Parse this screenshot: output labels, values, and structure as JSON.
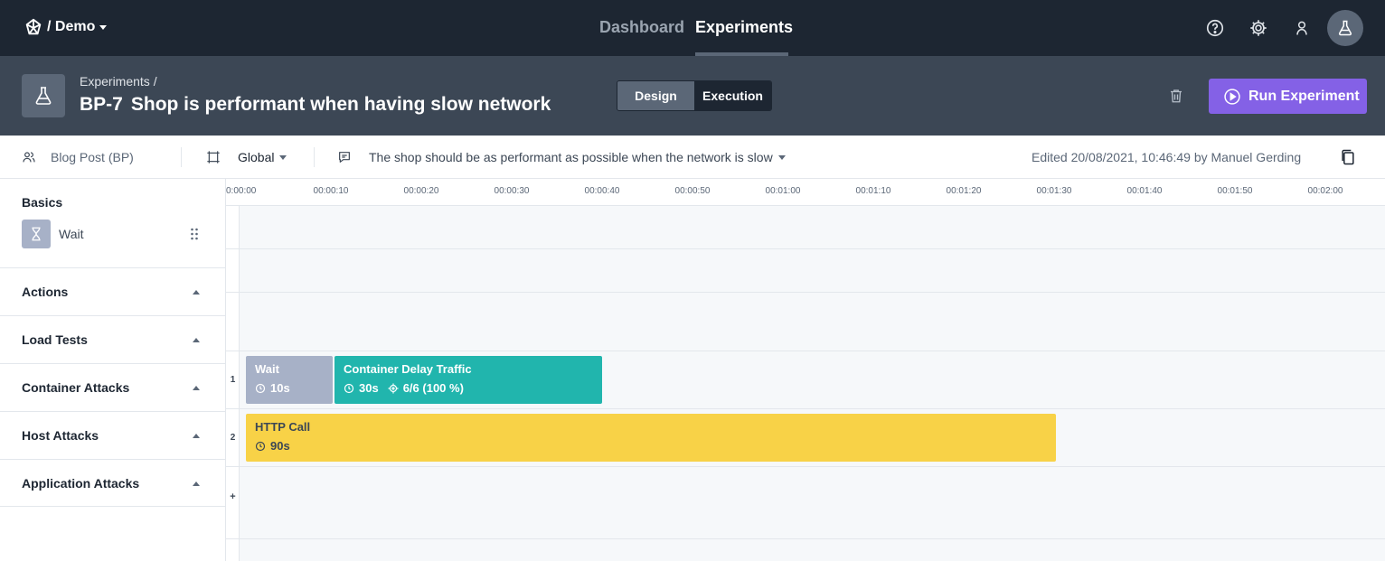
{
  "topnav": {
    "brand": "/ Demo",
    "tabs": [
      {
        "label": "Dashboard",
        "active": false
      },
      {
        "label": "Experiments",
        "active": true
      }
    ],
    "icons": [
      "help-icon",
      "settings-gear-icon",
      "user-icon",
      "flask-icon"
    ]
  },
  "experiment": {
    "breadcrumb": "Experiments /",
    "key": "BP-7",
    "name": "Shop is performant when having slow network",
    "tabs": {
      "design": "Design",
      "execution": "Execution"
    },
    "run_label": "Run Experiment",
    "accent": "#8461e6"
  },
  "subbar": {
    "team": "Blog Post (BP)",
    "environment": "Global",
    "hypothesis": "The shop should be as performant as possible when the network is slow",
    "edited": "Edited 20/08/2021, 10:46:49 by Manuel Gerding"
  },
  "sidebar": {
    "basics_title": "Basics",
    "basics_items": [
      {
        "label": "Wait",
        "icon": "hourglass-icon"
      }
    ],
    "sections": [
      "Actions",
      "Load Tests",
      "Container Attacks",
      "Host Attacks",
      "Application Attacks"
    ]
  },
  "timeline": {
    "ticks": [
      "0:00:00",
      "00:00:10",
      "00:00:20",
      "00:00:30",
      "00:00:40",
      "00:00:50",
      "00:01:00",
      "00:01:10",
      "00:01:20",
      "00:01:30",
      "00:01:40",
      "00:01:50",
      "00:02:00"
    ],
    "lanes": [
      {
        "number": "1",
        "steps": [
          {
            "name": "Wait",
            "duration": "10s",
            "color": "#a7b1c7"
          },
          {
            "name": "Container Delay Traffic",
            "duration": "30s",
            "targets": "6/6 (100 %)",
            "color": "#21b5ad"
          }
        ]
      },
      {
        "number": "2",
        "steps": [
          {
            "name": "HTTP Call",
            "duration": "90s",
            "color": "#f8d247"
          }
        ]
      }
    ],
    "add_lane": "+"
  }
}
